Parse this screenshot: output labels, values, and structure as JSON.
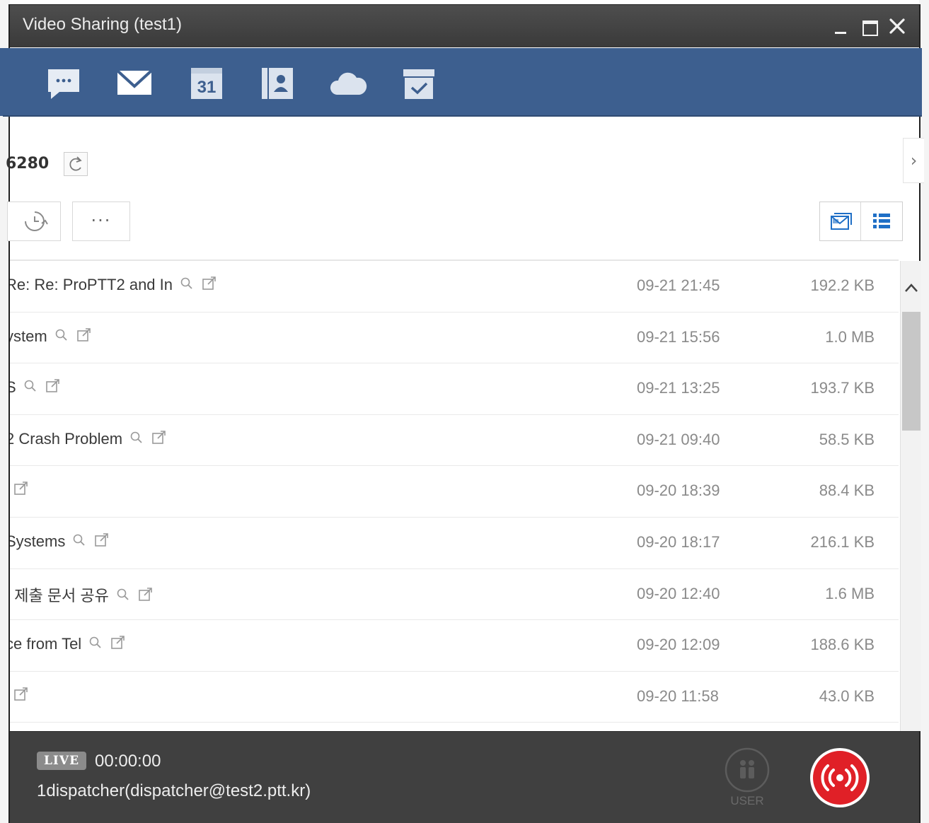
{
  "window": {
    "title": "Video Sharing (test1)"
  },
  "app_toolbar": {
    "icons": [
      "chat-icon",
      "mail-icon",
      "calendar-icon",
      "contacts-icon",
      "cloud-icon",
      "task-icon"
    ],
    "calendar_day": "31"
  },
  "mailbox": {
    "account_fragment": "6280",
    "side_arrow": "›",
    "more_label": "···"
  },
  "messages": [
    {
      "subject": "Re: Re: ProPTT2 and In",
      "date": "09-21 21:45",
      "size": "192.2 KB",
      "search": true
    },
    {
      "subject": "ystem",
      "date": "09-21 15:56",
      "size": "1.0 MB",
      "search": true
    },
    {
      "subject": "S",
      "date": "09-21 13:25",
      "size": "193.7 KB",
      "search": true
    },
    {
      "subject": "2 Crash Problem",
      "date": "09-21 09:40",
      "size": "58.5 KB",
      "search": true
    },
    {
      "subject": "",
      "date": "09-20 18:39",
      "size": "88.4 KB",
      "search": false
    },
    {
      "subject": "Systems",
      "date": "09-20 18:17",
      "size": "216.1 KB",
      "search": true
    },
    {
      "subject": "! 제출 문서 공유",
      "date": "09-20 12:40",
      "size": "1.6 MB",
      "search": true
    },
    {
      "subject": "ce from Tel",
      "date": "09-20 12:09",
      "size": "188.6 KB",
      "search": true
    },
    {
      "subject": "",
      "date": "09-20 11:58",
      "size": "43.0 KB",
      "search": false
    }
  ],
  "live": {
    "badge": "LIVE",
    "time": "00:00:00",
    "caller": "1dispatcher(dispatcher@test2.ptt.kr)",
    "user_label": "USER"
  },
  "colors": {
    "app_bar": "#3d5f8f",
    "title_bar": "#444444",
    "footer": "#404040",
    "broadcast_red": "#e02027",
    "accent_blue": "#1f6fc6"
  }
}
